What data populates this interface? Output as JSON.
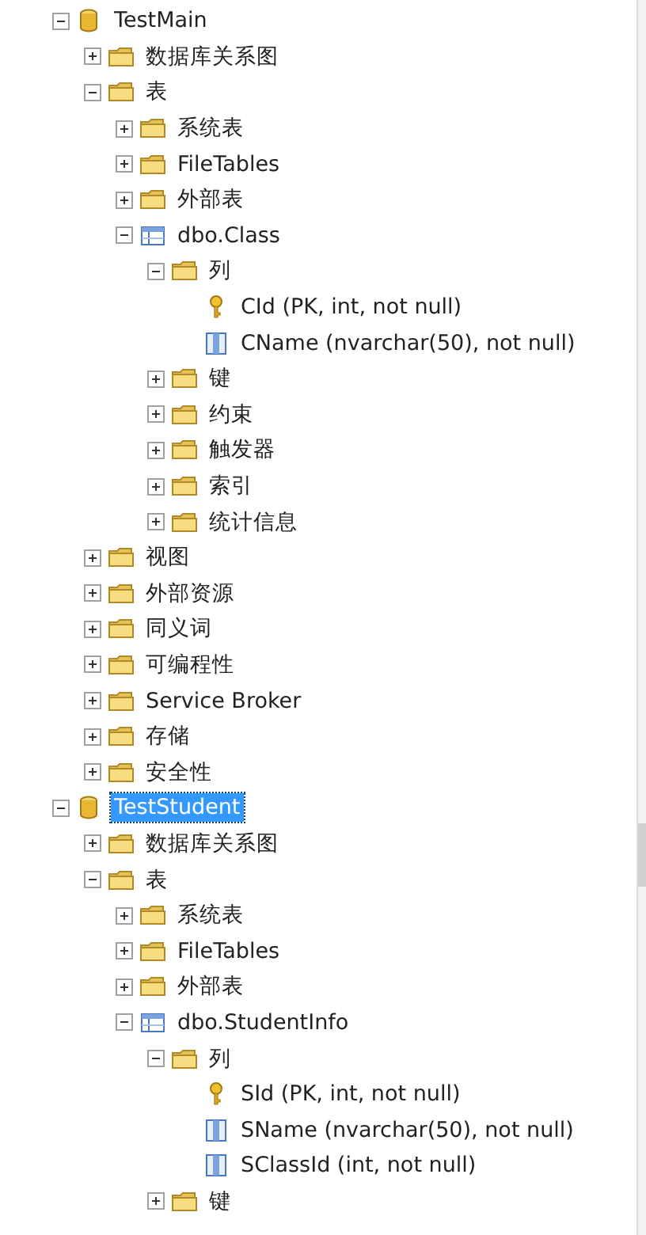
{
  "tree": [
    {
      "label": "TestMain",
      "kind": "database",
      "expanded": true,
      "selected": false,
      "children": [
        {
          "label": "数据库关系图",
          "kind": "folder",
          "expanded": false,
          "selected": false
        },
        {
          "label": "表",
          "kind": "folder",
          "expanded": true,
          "selected": false,
          "children": [
            {
              "label": "系统表",
              "kind": "folder",
              "expanded": false,
              "selected": false
            },
            {
              "label": "FileTables",
              "kind": "folder",
              "expanded": false,
              "selected": false
            },
            {
              "label": "外部表",
              "kind": "folder",
              "expanded": false,
              "selected": false
            },
            {
              "label": "dbo.Class",
              "kind": "table",
              "expanded": true,
              "selected": false,
              "children": [
                {
                  "label": "列",
                  "kind": "folder",
                  "expanded": true,
                  "selected": false,
                  "children": [
                    {
                      "label": "CId (PK, int, not null)",
                      "kind": "key-column",
                      "selected": false
                    },
                    {
                      "label": "CName (nvarchar(50), not null)",
                      "kind": "column",
                      "selected": false
                    }
                  ]
                },
                {
                  "label": "键",
                  "kind": "folder",
                  "expanded": false,
                  "selected": false
                },
                {
                  "label": "约束",
                  "kind": "folder",
                  "expanded": false,
                  "selected": false
                },
                {
                  "label": "触发器",
                  "kind": "folder",
                  "expanded": false,
                  "selected": false
                },
                {
                  "label": "索引",
                  "kind": "folder",
                  "expanded": false,
                  "selected": false
                },
                {
                  "label": "统计信息",
                  "kind": "folder",
                  "expanded": false,
                  "selected": false
                }
              ]
            }
          ]
        },
        {
          "label": "视图",
          "kind": "folder",
          "expanded": false,
          "selected": false
        },
        {
          "label": "外部资源",
          "kind": "folder",
          "expanded": false,
          "selected": false
        },
        {
          "label": "同义词",
          "kind": "folder",
          "expanded": false,
          "selected": false
        },
        {
          "label": "可编程性",
          "kind": "folder",
          "expanded": false,
          "selected": false
        },
        {
          "label": "Service Broker",
          "kind": "folder",
          "expanded": false,
          "selected": false
        },
        {
          "label": "存储",
          "kind": "folder",
          "expanded": false,
          "selected": false
        },
        {
          "label": "安全性",
          "kind": "folder",
          "expanded": false,
          "selected": false
        }
      ]
    },
    {
      "label": "TestStudent",
      "kind": "database",
      "expanded": true,
      "selected": true,
      "children": [
        {
          "label": "数据库关系图",
          "kind": "folder",
          "expanded": false,
          "selected": false
        },
        {
          "label": "表",
          "kind": "folder",
          "expanded": true,
          "selected": false,
          "children": [
            {
              "label": "系统表",
              "kind": "folder",
              "expanded": false,
              "selected": false
            },
            {
              "label": "FileTables",
              "kind": "folder",
              "expanded": false,
              "selected": false
            },
            {
              "label": "外部表",
              "kind": "folder",
              "expanded": false,
              "selected": false
            },
            {
              "label": "dbo.StudentInfo",
              "kind": "table",
              "expanded": true,
              "selected": false,
              "children": [
                {
                  "label": "列",
                  "kind": "folder",
                  "expanded": true,
                  "selected": false,
                  "children": [
                    {
                      "label": "SId (PK, int, not null)",
                      "kind": "key-column",
                      "selected": false
                    },
                    {
                      "label": "SName (nvarchar(50), not null)",
                      "kind": "column",
                      "selected": false
                    },
                    {
                      "label": "SClassId (int, not null)",
                      "kind": "column",
                      "selected": false
                    }
                  ]
                },
                {
                  "label": "键",
                  "kind": "folder",
                  "expanded": false,
                  "selected": false
                }
              ]
            }
          ]
        }
      ]
    }
  ]
}
